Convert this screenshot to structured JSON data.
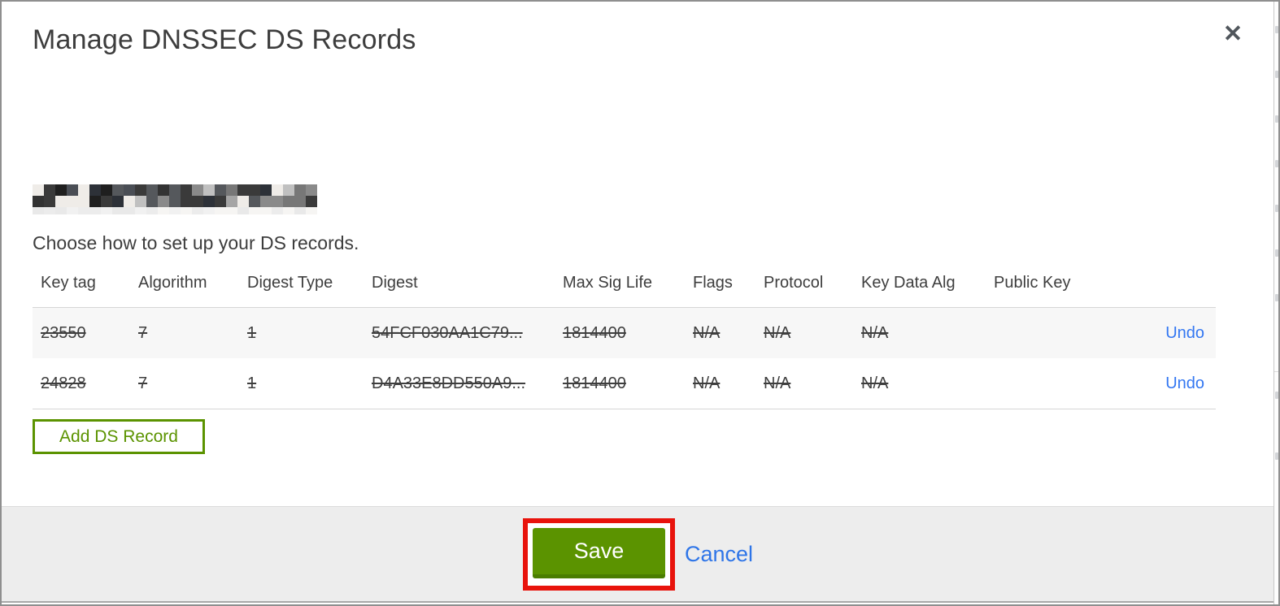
{
  "dialog": {
    "title": "Manage DNSSEC DS Records",
    "close_icon": "✕",
    "intro": "Choose how to set up your DS records.",
    "add_ds_record_label": "Add DS Record",
    "save_label": "Save",
    "cancel_label": "Cancel"
  },
  "table": {
    "headers": [
      "Key tag",
      "Algorithm",
      "Digest Type",
      "Digest",
      "Max Sig Life",
      "Flags",
      "Protocol",
      "Key Data Alg",
      "Public Key"
    ],
    "rows": [
      {
        "key_tag": "23550",
        "algorithm": "7",
        "digest_type": "1",
        "digest": "54FCF030AA1C79...",
        "max_sig_life": "1814400",
        "flags": "N/A",
        "protocol": "N/A",
        "key_data_alg": "N/A",
        "public_key": "",
        "action_label": "Undo",
        "deleted": true
      },
      {
        "key_tag": "24828",
        "algorithm": "7",
        "digest_type": "1",
        "digest": "D4A33E8DD550A9...",
        "max_sig_life": "1814400",
        "flags": "N/A",
        "protocol": "N/A",
        "key_data_alg": "N/A",
        "public_key": "",
        "action_label": "Undo",
        "deleted": true
      }
    ]
  },
  "colors": {
    "accent_green": "#5b9300",
    "accent_green_dark": "#4a7d00",
    "link_blue": "#2e75e8",
    "annotation_red": "#e8130c",
    "footer_bg": "#ededed",
    "alt_row_bg": "#f7f7f7"
  }
}
